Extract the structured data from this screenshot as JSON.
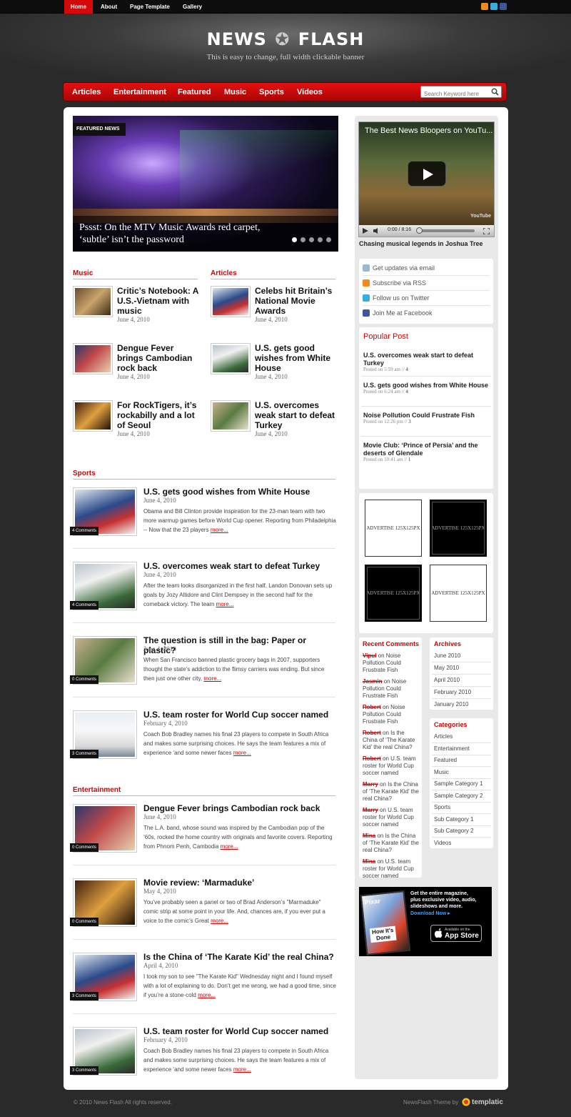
{
  "topnav": {
    "items": [
      "Home",
      "About",
      "Page Template",
      "Gallery"
    ]
  },
  "brand": {
    "logo_left": "NEWS",
    "logo_right": "FLASH",
    "tagline": "This is easy to change, full width clickable banner"
  },
  "mainnav": {
    "items": [
      "Articles",
      "Entertainment",
      "Featured",
      "Music",
      "Sports",
      "Videos"
    ]
  },
  "search": {
    "placeholder": "Search Keyword here"
  },
  "featured": {
    "label": "FEATURED NEWS",
    "caption": "Pssst: On the MTV Music Awards red carpet, ‘subtle’ isn’t the password",
    "dots": 5,
    "active_dot": 0
  },
  "music": {
    "title": "Music",
    "items": [
      {
        "title": "Critic’s Notebook: A U.S.-Vietnam with music",
        "date": "June 4, 2010"
      },
      {
        "title": "Dengue Fever brings Cambodian rock back",
        "date": "June 4, 2010"
      },
      {
        "title": "For RockTigers, it’s rockabilly and a lot of Seoul",
        "date": "June 4, 2010"
      }
    ]
  },
  "articles": {
    "title": "Articles",
    "items": [
      {
        "title": "Celebs hit Britain’s National Movie Awards",
        "date": "June 4, 2010"
      },
      {
        "title": "U.S. gets good wishes from White House",
        "date": "June 4, 2010"
      },
      {
        "title": "U.S. overcomes weak start to defeat Turkey",
        "date": "June 4, 2010"
      }
    ]
  },
  "sports": {
    "title": "Sports",
    "items": [
      {
        "title": "U.S. gets good wishes from White House",
        "date": "June 4, 2010",
        "excerpt": "Obama and Bill Clinton provide inspiration for the 23-man team with two more warmup games before World Cup opener. Reporting from Philadelphia -- Now that the 23 players",
        "comments": "4 Comments"
      },
      {
        "title": "U.S. overcomes weak start to defeat Turkey",
        "date": "June 4, 2010",
        "excerpt": "After the team looks disorganized in the first half, Landon Donovan sets up goals by Jozy Altidore and Clint Dempsey in the second half for the comeback victory. The team",
        "comments": "4 Comments"
      },
      {
        "title": "The question is still in the bag: Paper or plastic?",
        "date": "June 4, 2010",
        "excerpt": "When San Francisco banned plastic grocery bags in 2007, supporters thought the state’s addiction to the flimsy carriers was ending. But since then just one other city,",
        "comments": "0 Comments"
      },
      {
        "title": "U.S. team roster for World Cup soccer named",
        "date": "February 4, 2010",
        "excerpt": "Coach Bob Bradley names his final 23 players to compete in South Africa and makes some surprising choices. He says the team features a mix of experience ‘and some newer faces",
        "comments": "3 Comments"
      }
    ]
  },
  "entertainment": {
    "title": "Entertainment",
    "items": [
      {
        "title": "Dengue Fever brings Cambodian rock back",
        "date": "June 4, 2010",
        "excerpt": "The L.A. band, whose sound was inspired by the Cambodian pop of the ’60s, rocked the home country with originals and favorite covers. Reporting from Phnom Penh, Cambodia",
        "comments": "0 Comments"
      },
      {
        "title": "Movie review: ‘Marmaduke’",
        "date": "May 4, 2010",
        "excerpt": "You’ve probably seen a panel or two of Brad Anderson’s \"Marmaduke\" comic strip at some point in your life. And, chances are, if you ever put a voice to the comic’s Great",
        "comments": "0 Comments"
      },
      {
        "title": "Is the China of ‘The Karate Kid’ the real China?",
        "date": "April 4, 2010",
        "excerpt": "I took my son to see \"The Karate Kid\" Wednesday night and I found myself with a lot of explaining to do. Don’t get me wrong, we had a good time, since if you’re a stone-cold",
        "comments": "3 Comments"
      },
      {
        "title": "U.S. team roster for World Cup soccer named",
        "date": "February 4, 2010",
        "excerpt": "Coach Bob Bradley names his final 23 players to compete in South Africa and makes some surprising choices. He says the team features a mix of experience ‘and some newer faces",
        "comments": "3 Comments"
      }
    ]
  },
  "more_label": "more...",
  "video": {
    "title": "The Best News Bloopers on YouTu...",
    "time": "0:00 / 8:16",
    "watermark": "YouTube",
    "caption": "Chasing musical legends in Joshua Tree"
  },
  "subscribe": {
    "items": [
      "Get updates via email",
      "Subscribe via RSS",
      "Follow us on Twitter",
      "Join Me at Facebook"
    ]
  },
  "popular": {
    "title": "Popular Post",
    "items": [
      {
        "title": "U.S. overcomes weak start to defeat Turkey",
        "meta": "Posted on 5:59 am //",
        "count": "4"
      },
      {
        "title": "U.S. gets good wishes from White House",
        "meta": "Posted on 6:24 am //",
        "count": "4"
      },
      {
        "title": "Noise Pollution Could Frustrate Fish",
        "meta": "Posted on 12:26 pm //",
        "count": "3"
      },
      {
        "title": "Movie Club: ‘Prince of Persia’ and the deserts of Glendale",
        "meta": "Posted on 10:41 am //",
        "count": "1"
      }
    ]
  },
  "ads": {
    "label": "ADVERTISE 125X125PX"
  },
  "recent_comments": {
    "title": "Recent Comments",
    "items": [
      {
        "user": "Vipul",
        "text": " on Noise Pollution Could Frustrate Fish"
      },
      {
        "user": "Jasmin",
        "text": " on Noise Pollution Could Frustrate Fish"
      },
      {
        "user": "Robert",
        "text": " on Noise Pollution Could Frustrate Fish"
      },
      {
        "user": "Robert",
        "text": " on Is the China of ‘The Karate Kid’ the real China?"
      },
      {
        "user": "Robert",
        "text": " on U.S. team roster for World Cup soccer named"
      },
      {
        "user": "Marry",
        "text": " on Is the China of ‘The Karate Kid’ the real China?"
      },
      {
        "user": "Marry",
        "text": " on U.S. team roster for World Cup soccer named"
      },
      {
        "user": "Mina",
        "text": " on Is the China of ‘The Karate Kid’ the real China?"
      },
      {
        "user": "Mina",
        "text": " on U.S. team roster for World Cup soccer named"
      }
    ]
  },
  "archives": {
    "title": "Archives",
    "items": [
      "June 2010",
      "May 2010",
      "April 2010",
      "February 2010",
      "January 2010"
    ]
  },
  "categories": {
    "title": "Categories",
    "items": [
      "Articles",
      "Entertainment",
      "Featured",
      "Music",
      "Sample Category 1",
      "Sample Category 2",
      "Sports",
      "Sub Category 1",
      "Sub Category 2",
      "Videos"
    ]
  },
  "appad": {
    "line1": "Get the entire magazine,",
    "line2": "plus exclusive video, audio,",
    "line3": "slideshows and more.",
    "cta": "Download Now ▸",
    "badge_small": "Available on the",
    "badge_big": "App Store",
    "cover_title": "Pixar",
    "cover_tag": "How It's Done"
  },
  "footer": {
    "copyright": "© 2010 News Flash All rights reserved.",
    "theme": "NewsFlash Theme by",
    "brand": "templatic"
  }
}
